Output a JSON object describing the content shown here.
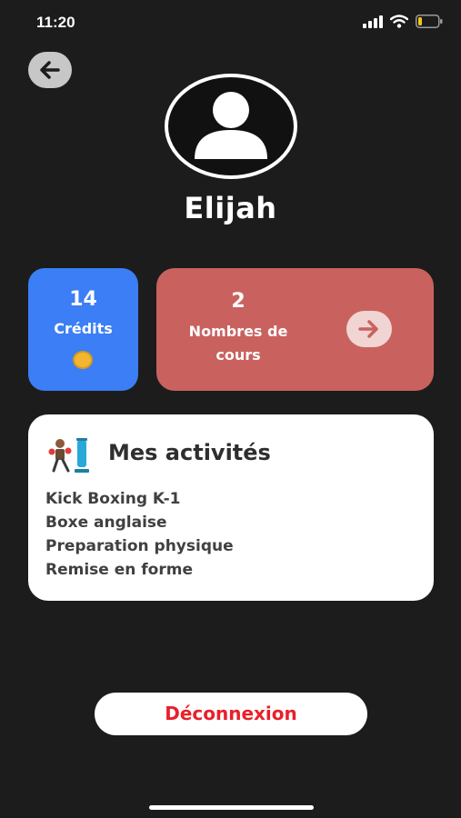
{
  "status_bar": {
    "time": "11:20",
    "icons": [
      "signal-icon",
      "wifi-icon",
      "battery-icon"
    ],
    "battery_color": "#f5c518"
  },
  "header": {
    "back_icon": "arrow-left-icon",
    "avatar_icon": "user-icon"
  },
  "user": {
    "name": "Elijah"
  },
  "credits_card": {
    "value": "14",
    "label": "Crédits",
    "icon": "coin-icon",
    "color": "#3b7ef5"
  },
  "courses_card": {
    "value": "2",
    "label_line1": "Nombres de",
    "label_line2": "cours",
    "icon": "arrow-right-icon",
    "color": "#c9625f"
  },
  "activities": {
    "title": "Mes activités",
    "icon": "boxing-icon",
    "items": [
      "Kick Boxing K-1",
      "Boxe anglaise",
      "Preparation physique",
      "Remise en forme"
    ]
  },
  "logout": {
    "label": "Déconnexion",
    "color": "#e8202a"
  }
}
